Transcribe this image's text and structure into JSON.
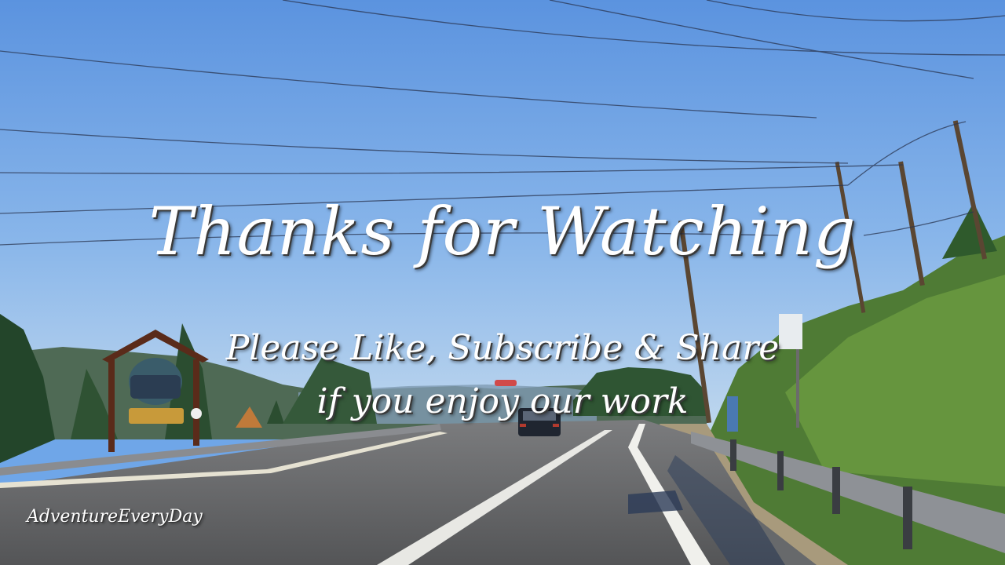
{
  "overlay": {
    "title": "Thanks for Watching",
    "subtitle_line1": "Please Like, Subscribe & Share",
    "subtitle_line2": "if you enjoy our work",
    "watermark": "AdventureEveryDay"
  },
  "colors": {
    "sky_top": "#5e97e0",
    "sky_bottom": "#b7d3ee",
    "road": "#5f6062",
    "text": "#ffffff"
  }
}
